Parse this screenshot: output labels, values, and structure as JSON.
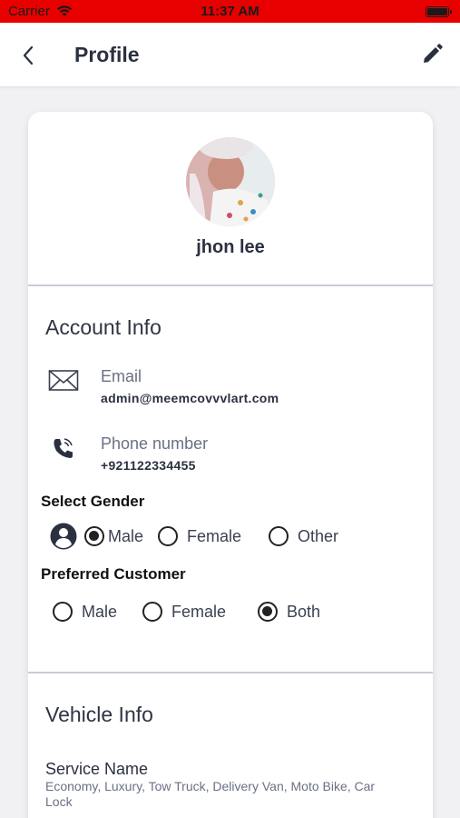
{
  "status_bar": {
    "carrier": "Carrier",
    "time": "11:37 AM"
  },
  "header": {
    "title": "Profile"
  },
  "profile": {
    "name": "jhon lee"
  },
  "account_info": {
    "title": "Account Info",
    "email_label": "Email",
    "email_value": "admin@meemcovvvlart.com",
    "phone_label": "Phone number",
    "phone_value": "+921122334455"
  },
  "gender": {
    "title": "Select Gender",
    "options": [
      "Male",
      "Female",
      "Other"
    ],
    "selected": "Male"
  },
  "preferred_customer": {
    "title": "Preferred Customer",
    "options": [
      "Male",
      "Female",
      "Both"
    ],
    "selected": "Both"
  },
  "vehicle_info": {
    "title": "Vehicle Info",
    "service_label": "Service Name",
    "service_value": "Economy, Luxury, Tow Truck, Delivery Van, Moto Bike, Car Lock"
  },
  "colors": {
    "status_bar": "#e80000",
    "card": "#ffffff",
    "background": "#f1f1f3"
  }
}
